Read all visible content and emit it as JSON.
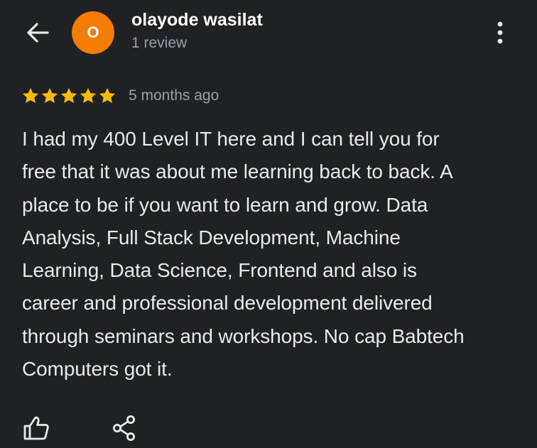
{
  "header": {
    "back_icon": "arrow-back-icon",
    "avatar_letter": "O",
    "avatar_color": "#f57c00",
    "user_name": "olayode wasilat",
    "review_count": "1 review",
    "more_icon": "more-vert-icon"
  },
  "review": {
    "rating": 5,
    "rating_max": 5,
    "star_color": "#fbbc04",
    "time_ago": "5 months ago",
    "text_lines": [
      "I had my 400 Level IT here and I can tell you for",
      "free that it was about me learning back to back. A",
      "place to be if you want to learn and grow. Data",
      "Analysis, Full Stack Development, Machine",
      "Learning, Data Science, Frontend and also is",
      "career and professional development delivered",
      "through seminars and workshops. No cap Babtech",
      "Computers got it."
    ]
  },
  "actions": {
    "like_icon": "thumb-up-icon",
    "share_icon": "share-icon"
  },
  "theme": {
    "background": "#202124",
    "text": "#e8eaed",
    "muted_text": "#9aa0a6"
  }
}
